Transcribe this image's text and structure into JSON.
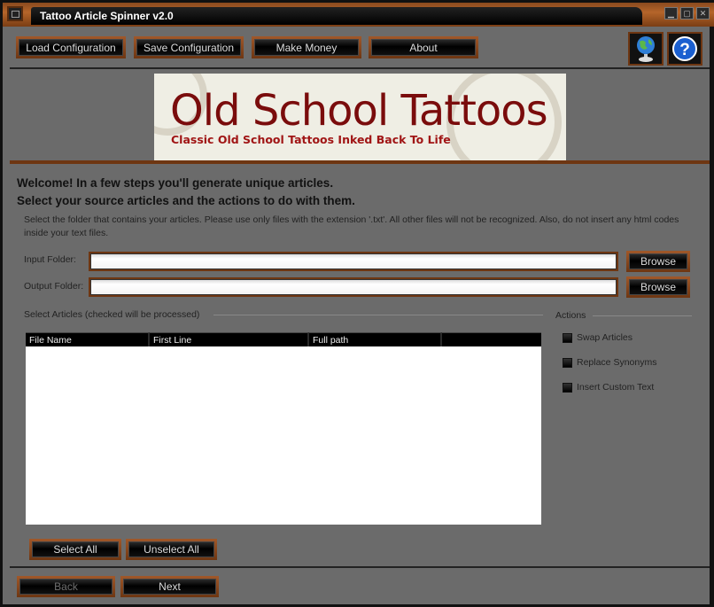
{
  "window": {
    "title": "Tattoo Article Spinner v2.0",
    "controls": [
      "minimize",
      "maximize",
      "close"
    ]
  },
  "toolbar": {
    "load_config": "Load Configuration",
    "save_config": "Save Configuration",
    "make_money": "Make Money",
    "about": "About",
    "icons": {
      "web": "globe-icon",
      "help": "help-icon"
    }
  },
  "banner": {
    "title": "Old School Tattoos",
    "subtitle": "Classic Old School Tattoos Inked Back To Life"
  },
  "main": {
    "heading1": "Welcome! In a few steps you'll generate unique articles.",
    "heading2": "Select your source articles and the actions to do with them.",
    "note": "Select the folder that contains your articles. Please use only files with the extension '.txt'. All other files will not be recognized. Also, do not insert any html codes inside your text files.",
    "input_folder_label": "Input Folder:",
    "input_folder_value": "",
    "output_folder_label": "Output Folder:",
    "output_folder_value": "",
    "browse_label": "Browse",
    "articles_group_label": "Select Articles (checked will be processed)",
    "columns": [
      "File Name",
      "First Line",
      "Full path",
      ""
    ],
    "rows": [],
    "select_all": "Select All",
    "unselect_all": "Unselect All"
  },
  "actions": {
    "group_label": "Actions",
    "items": [
      {
        "label": "Swap Articles",
        "checked": false
      },
      {
        "label": "Replace Synonyms",
        "checked": false
      },
      {
        "label": "Insert Custom Text",
        "checked": false
      }
    ]
  },
  "nav": {
    "back": "Back",
    "back_enabled": false,
    "next": "Next"
  }
}
